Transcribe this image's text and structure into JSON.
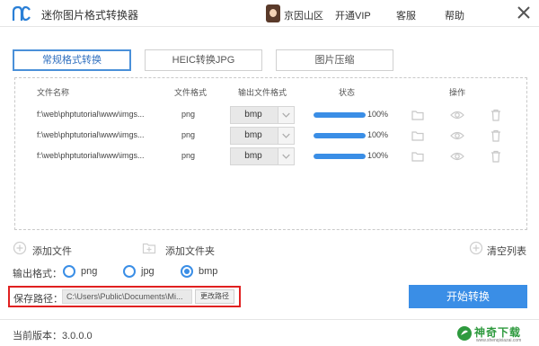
{
  "app": {
    "title": "迷你图片格式转换器",
    "user": "京因山区",
    "nav": {
      "vip": "开通VIP",
      "service": "客服",
      "help": "帮助"
    }
  },
  "tabs": [
    {
      "label": "常规格式转换",
      "active": true
    },
    {
      "label": "HEIC转换JPG",
      "active": false
    },
    {
      "label": "图片压缩",
      "active": false
    }
  ],
  "table": {
    "headers": {
      "name": "文件名称",
      "format": "文件格式",
      "output": "输出文件格式",
      "status": "状态",
      "ops": "操作"
    },
    "rows": [
      {
        "name": "f:\\web\\phptutorial\\www\\imgs...",
        "format": "png",
        "output": "bmp",
        "progress": "100%",
        "progress_fraction": 1.0
      },
      {
        "name": "f:\\web\\phptutorial\\www\\imgs...",
        "format": "png",
        "output": "bmp",
        "progress": "100%",
        "progress_fraction": 1.0
      },
      {
        "name": "f:\\web\\phptutorial\\www\\imgs...",
        "format": "png",
        "output": "bmp",
        "progress": "100%",
        "progress_fraction": 1.0
      }
    ]
  },
  "actions": {
    "add_file": "添加文件",
    "add_folder": "添加文件夹",
    "clear_list": "清空列表"
  },
  "output_format": {
    "label": "输出格式：",
    "options": [
      "png",
      "jpg",
      "bmp"
    ],
    "selected": "bmp"
  },
  "save_path": {
    "label": "保存路径：",
    "value": "C:\\Users\\Public\\Documents\\Mi...",
    "change_label": "更改路径"
  },
  "start_button": "开始转换",
  "footer": {
    "version": "当前版本：3.0.0.0",
    "watermark": "神奇下载",
    "watermark_sub": "www.shenqixiazai.com"
  },
  "colors": {
    "accent": "#3a8ee6",
    "highlight_border": "#e02020",
    "watermark": "#2e9a3e"
  }
}
